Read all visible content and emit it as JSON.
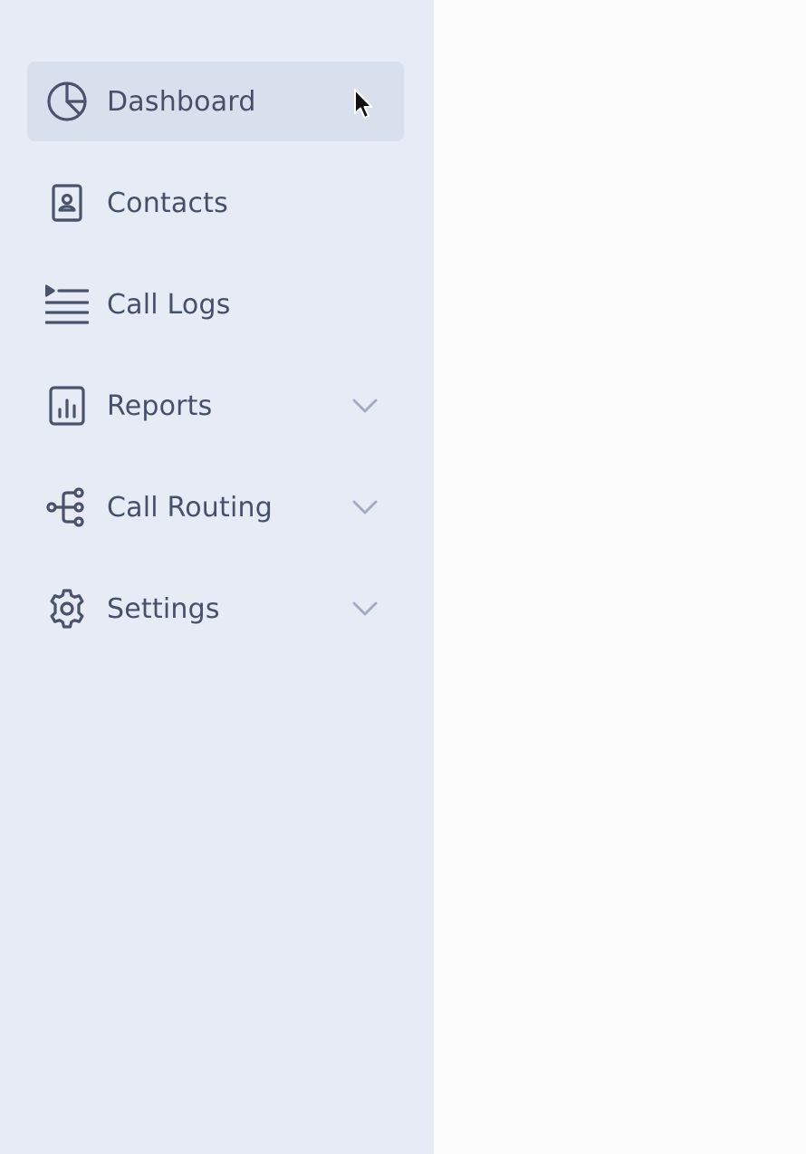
{
  "sidebar": {
    "items": [
      {
        "label": "Dashboard",
        "icon": "pie-chart-icon",
        "active": true,
        "expandable": false
      },
      {
        "label": "Contacts",
        "icon": "contact-book-icon",
        "active": false,
        "expandable": false
      },
      {
        "label": "Call Logs",
        "icon": "list-play-icon",
        "active": false,
        "expandable": false
      },
      {
        "label": "Reports",
        "icon": "bar-chart-document-icon",
        "active": false,
        "expandable": true
      },
      {
        "label": "Call Routing",
        "icon": "routing-tree-icon",
        "active": false,
        "expandable": true
      },
      {
        "label": "Settings",
        "icon": "gear-icon",
        "active": false,
        "expandable": true
      }
    ]
  },
  "colors": {
    "sidebar_bg": "#e6ebf5",
    "active_item_bg": "#d8e0ee",
    "text": "#475069",
    "icon": "#4a536b",
    "chevron": "#a3abc2",
    "main_bg": "#fcfcfd"
  }
}
